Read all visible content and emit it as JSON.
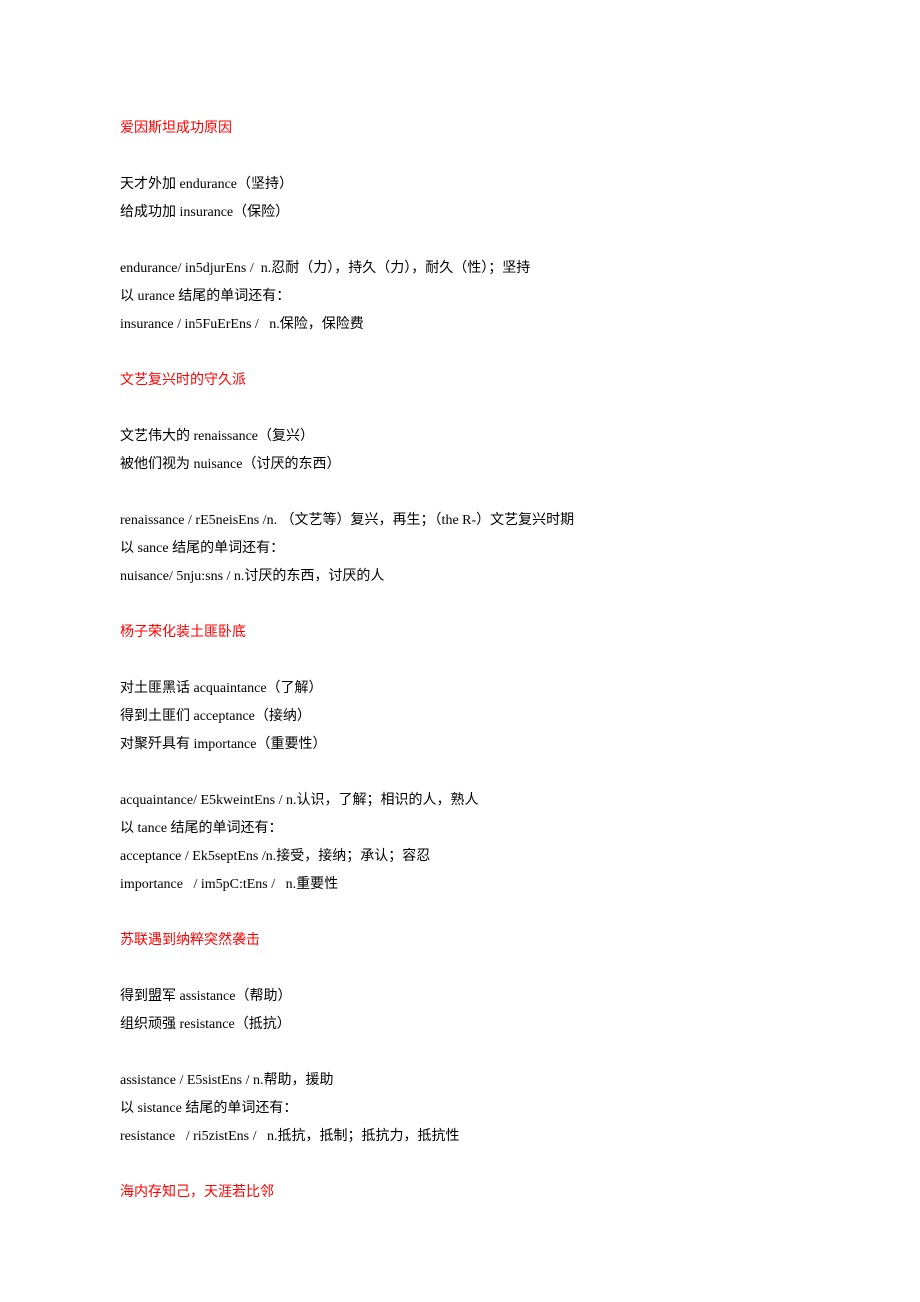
{
  "sections": [
    {
      "heading": "爱因斯坦成功原因",
      "blocks": [
        [
          "天才外加 endurance（坚持）",
          "给成功加 insurance（保险）"
        ],
        [
          "endurance/ in5djurEns /  n.忍耐（力），持久（力），耐久（性）；坚持",
          "以 urance 结尾的单词还有：",
          "insurance / in5FuErEns /   n.保险，保险费"
        ]
      ]
    },
    {
      "heading": "文艺复兴时的守久派",
      "blocks": [
        [
          "文艺伟大的 renaissance（复兴）",
          "被他们视为 nuisance（讨厌的东西）"
        ],
        [
          "renaissance / rE5neisEns /n. （文艺等）复兴，再生；（the R-）文艺复兴时期",
          "以 sance 结尾的单词还有：",
          "nuisance/ 5nju:sns / n.讨厌的东西，讨厌的人"
        ]
      ]
    },
    {
      "heading": "杨子荣化装土匪卧底",
      "blocks": [
        [
          "对土匪黑话 acquaintance（了解）",
          "得到土匪们 acceptance（接纳）",
          "对聚歼具有 importance（重要性）"
        ],
        [
          "acquaintance/ E5kweintEns / n.认识，了解；相识的人，熟人",
          "以 tance 结尾的单词还有：",
          "acceptance / Ek5septEns /n.接受，接纳；承认；容忍",
          "importance   / im5pC:tEns /   n.重要性"
        ]
      ]
    },
    {
      "heading": "苏联遇到纳粹突然袭击",
      "blocks": [
        [
          "得到盟军 assistance（帮助）",
          "组织顽强 resistance（抵抗）"
        ],
        [
          "assistance / E5sistEns / n.帮助，援助",
          "以 sistance 结尾的单词还有：",
          "resistance   / ri5zistEns /   n.抵抗，抵制；抵抗力，抵抗性"
        ]
      ]
    },
    {
      "heading": "海内存知己，天涯若比邻",
      "blocks": []
    }
  ]
}
